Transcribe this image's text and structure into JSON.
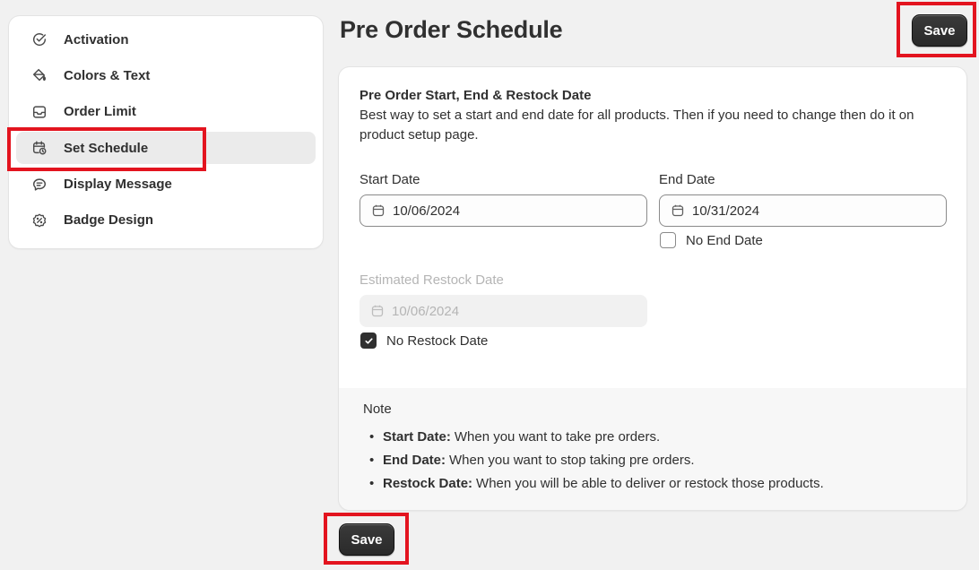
{
  "sidebar": {
    "items": [
      {
        "label": "Activation",
        "icon": "check-circle-icon",
        "active": false
      },
      {
        "label": "Colors & Text",
        "icon": "paint-bucket-icon",
        "active": false
      },
      {
        "label": "Order Limit",
        "icon": "inbox-icon",
        "active": false
      },
      {
        "label": "Set Schedule",
        "icon": "calendar-clock-icon",
        "active": true
      },
      {
        "label": "Display Message",
        "icon": "chat-icon",
        "active": false
      },
      {
        "label": "Badge Design",
        "icon": "discount-badge-icon",
        "active": false
      }
    ]
  },
  "header": {
    "title": "Pre Order Schedule",
    "save_label": "Save"
  },
  "card": {
    "title": "Pre Order Start, End & Restock Date",
    "description": "Best way to set a start and end date for all products. Then if you need to change then do it on product setup page.",
    "start_date": {
      "label": "Start Date",
      "value": "10/06/2024"
    },
    "end_date": {
      "label": "End Date",
      "value": "10/31/2024"
    },
    "no_end_date": {
      "label": "No End Date",
      "checked": false
    },
    "restock_date": {
      "label": "Estimated Restock Date",
      "value": "10/06/2024",
      "disabled": true
    },
    "no_restock_date": {
      "label": "No Restock Date",
      "checked": true
    }
  },
  "note": {
    "title": "Note",
    "items": [
      {
        "term": "Start Date:",
        "text": "When you want to take pre orders."
      },
      {
        "term": "End Date:",
        "text": "When you want to stop taking pre orders."
      },
      {
        "term": "Restock Date:",
        "text": "When you will be able to deliver or restock those products."
      }
    ]
  },
  "footer": {
    "save_label": "Save"
  },
  "colors": {
    "highlight": "#e3141f",
    "primary_button": "#303030",
    "background": "#f1f1f1"
  }
}
